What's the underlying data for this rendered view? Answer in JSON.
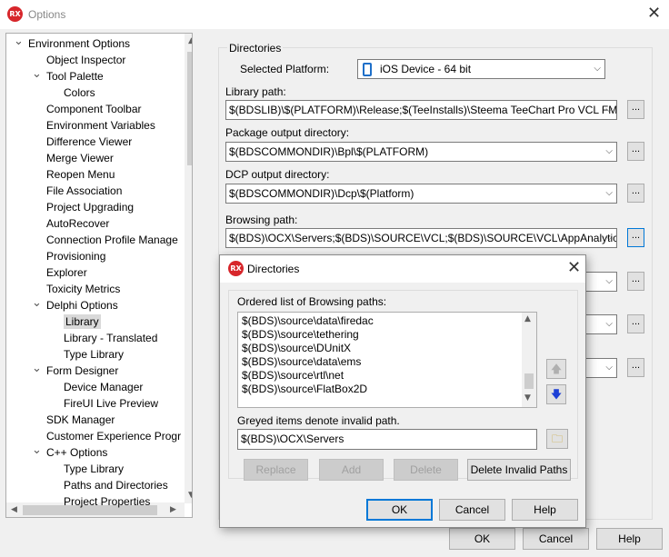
{
  "window": {
    "title": "Options",
    "logo": "RX"
  },
  "tree": {
    "items": [
      {
        "label": "Environment Options",
        "indent": 0,
        "expander": "down"
      },
      {
        "label": "Object Inspector",
        "indent": 1
      },
      {
        "label": "Tool Palette",
        "indent": 1,
        "expander": "down"
      },
      {
        "label": "Colors",
        "indent": 2
      },
      {
        "label": "Component Toolbar",
        "indent": 1
      },
      {
        "label": "Environment Variables",
        "indent": 1
      },
      {
        "label": "Difference Viewer",
        "indent": 1
      },
      {
        "label": "Merge Viewer",
        "indent": 1
      },
      {
        "label": "Reopen Menu",
        "indent": 1
      },
      {
        "label": "File Association",
        "indent": 1
      },
      {
        "label": "Project Upgrading",
        "indent": 1
      },
      {
        "label": "AutoRecover",
        "indent": 1
      },
      {
        "label": "Connection Profile Manage",
        "indent": 1
      },
      {
        "label": "Provisioning",
        "indent": 1
      },
      {
        "label": "Explorer",
        "indent": 1
      },
      {
        "label": "Toxicity Metrics",
        "indent": 1
      },
      {
        "label": "Delphi Options",
        "indent": 1,
        "expander": "down"
      },
      {
        "label": "Library",
        "indent": 2,
        "selected": true
      },
      {
        "label": "Library - Translated",
        "indent": 2
      },
      {
        "label": "Type Library",
        "indent": 2
      },
      {
        "label": "Form Designer",
        "indent": 1,
        "expander": "down"
      },
      {
        "label": "Device Manager",
        "indent": 2
      },
      {
        "label": "FireUI Live Preview",
        "indent": 2
      },
      {
        "label": "SDK Manager",
        "indent": 1
      },
      {
        "label": "Customer Experience Progr",
        "indent": 1
      },
      {
        "label": "C++ Options",
        "indent": 1,
        "expander": "down"
      },
      {
        "label": "Type Library",
        "indent": 2
      },
      {
        "label": "Paths and Directories",
        "indent": 2
      },
      {
        "label": "Project Properties",
        "indent": 2
      }
    ]
  },
  "directories": {
    "group_label": "Directories",
    "platform_label": "Selected Platform:",
    "platform_value": "iOS Device - 64 bit",
    "library_path_label": "Library path:",
    "library_path_value": "$(BDSLIB)\\$(PLATFORM)\\Release;$(TeeInstalls)\\Steema TeeChart Pro VCL FMX",
    "package_output_label": "Package output directory:",
    "package_output_value": "$(BDSCOMMONDIR)\\Bpl\\$(PLATFORM)",
    "dcp_output_label": "DCP output directory:",
    "dcp_output_value": "$(BDSCOMMONDIR)\\Dcp\\$(Platform)",
    "browsing_path_label": "Browsing path:",
    "browsing_path_value": "$(BDS)\\OCX\\Servers;$(BDS)\\SOURCE\\VCL;$(BDS)\\SOURCE\\VCL\\AppAnalytics;",
    "ellipsis": "..."
  },
  "dialog": {
    "title": "Directories",
    "list_label": "Ordered list of Browsing paths:",
    "paths": [
      "$(BDS)\\source\\data\\firedac",
      "$(BDS)\\source\\tethering",
      "$(BDS)\\source\\DUnitX",
      "$(BDS)\\source\\data\\ems",
      "$(BDS)\\source\\rtl\\net",
      "$(BDS)\\source\\FlatBox2D"
    ],
    "greyed_note": "Greyed items denote invalid path.",
    "path_value": "$(BDS)\\OCX\\Servers",
    "buttons": {
      "replace": "Replace",
      "add": "Add",
      "delete": "Delete",
      "delete_invalid": "Delete Invalid Paths",
      "ok": "OK",
      "cancel": "Cancel",
      "help": "Help"
    }
  },
  "footer": {
    "ok": "OK",
    "cancel": "Cancel",
    "help": "Help"
  }
}
